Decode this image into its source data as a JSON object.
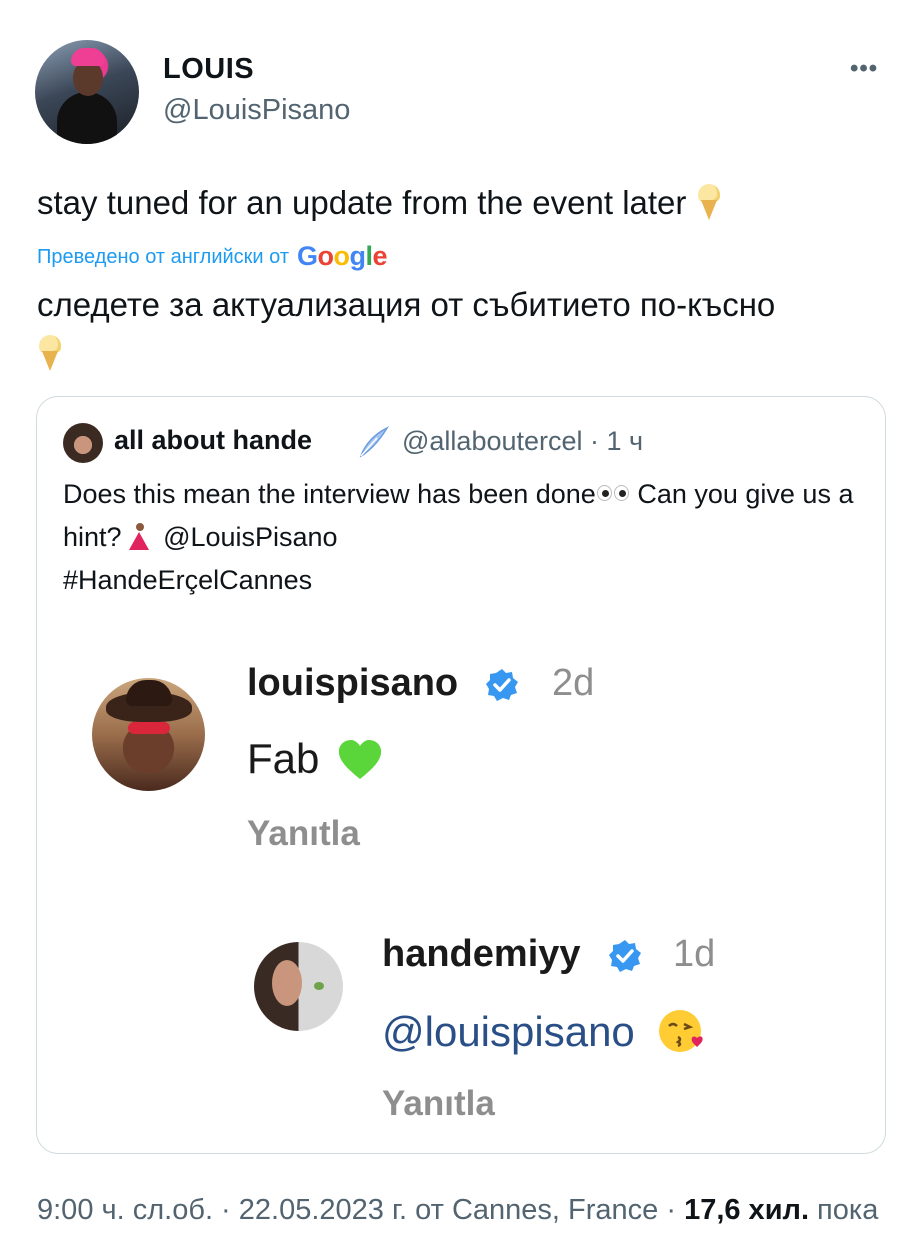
{
  "tweet": {
    "display_name": "LOUIS",
    "handle": "@LouisPisano",
    "more_icon": "more-horizontal-icon",
    "text": "stay tuned for an update from the event later",
    "translated_by_label": "Преведено от английски от",
    "google_wordmark": "Google",
    "google_colors": [
      "#4285F4",
      "#EA4335",
      "#FBBC05",
      "#4285F4",
      "#34A853",
      "#EA4335"
    ],
    "translation": "следете за актуализация от събитието по-късно"
  },
  "quote": {
    "name": "all about hande",
    "handle_time": "@allaboutercel · 1 ч",
    "text_part1": "Does this mean the interview has been done",
    "text_part2": " Can you give us a hint?",
    "text_part3": " @LouisPisano",
    "text_part4": "#HandeErçelCannes",
    "embedded": {
      "comment1": {
        "username": "louispisano",
        "time": "2d",
        "text": "Fab",
        "reply": "Yanıtla"
      },
      "comment2": {
        "username": "handemiyy",
        "time": "1d",
        "text": "@louispisano",
        "reply": "Yanıtla"
      }
    }
  },
  "footer": {
    "meta": "9:00 ч. сл.об. · 22.05.2023 г. от Cannes, France · ",
    "views_count": "17,6 хил.",
    "views_label": " пока"
  },
  "colors": {
    "link_blue": "#1d9bf0",
    "secondary_text": "#536471",
    "verified_blue": "#3897f0",
    "mention_blue": "#2a4f87"
  }
}
